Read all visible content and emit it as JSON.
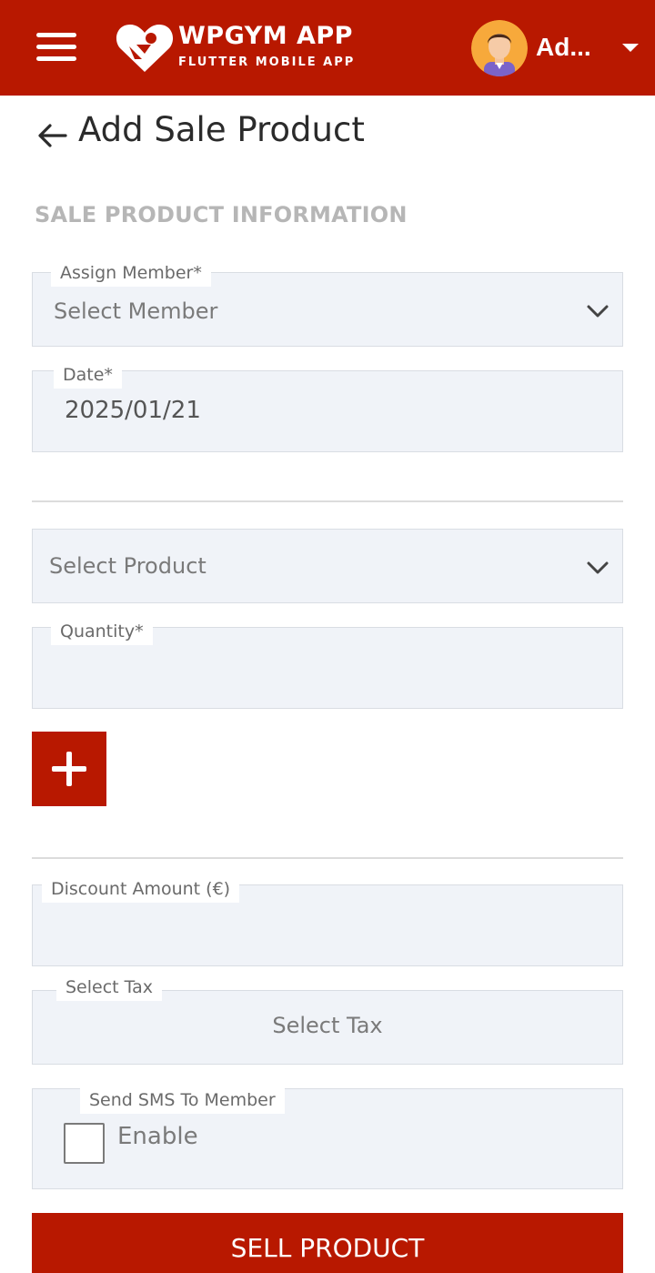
{
  "app_bar": {
    "brand_title": "WPGYM APP",
    "brand_subtitle": "FLUTTER MOBILE APP",
    "user_name": "Ad...",
    "menu_icon": "hamburger-menu-icon",
    "dropdown_icon": "caret-down-icon",
    "background_color": "#b81800"
  },
  "page": {
    "title": "Add Sale Product",
    "section_title": "SALE PRODUCT INFORMATION"
  },
  "form": {
    "assign_member": {
      "label": "Assign Member*",
      "value": "Select Member"
    },
    "date": {
      "label": "Date*",
      "value": "2025/01/21"
    },
    "product": {
      "value": "Select Product"
    },
    "quantity": {
      "label": "Quantity*",
      "value": ""
    },
    "discount": {
      "label": "Discount Amount (€)",
      "value": ""
    },
    "tax": {
      "label": "Select Tax",
      "value": "Select Tax"
    },
    "sms": {
      "label": "Send SMS To Member",
      "checkbox_label": "Enable",
      "checked": false
    }
  },
  "buttons": {
    "add_product_icon": "plus-icon",
    "sell_label": "SELL PRODUCT"
  },
  "colors": {
    "accent": "#b81800",
    "field_bg": "#f0f3f8",
    "section_title": "#b6b6b6"
  }
}
